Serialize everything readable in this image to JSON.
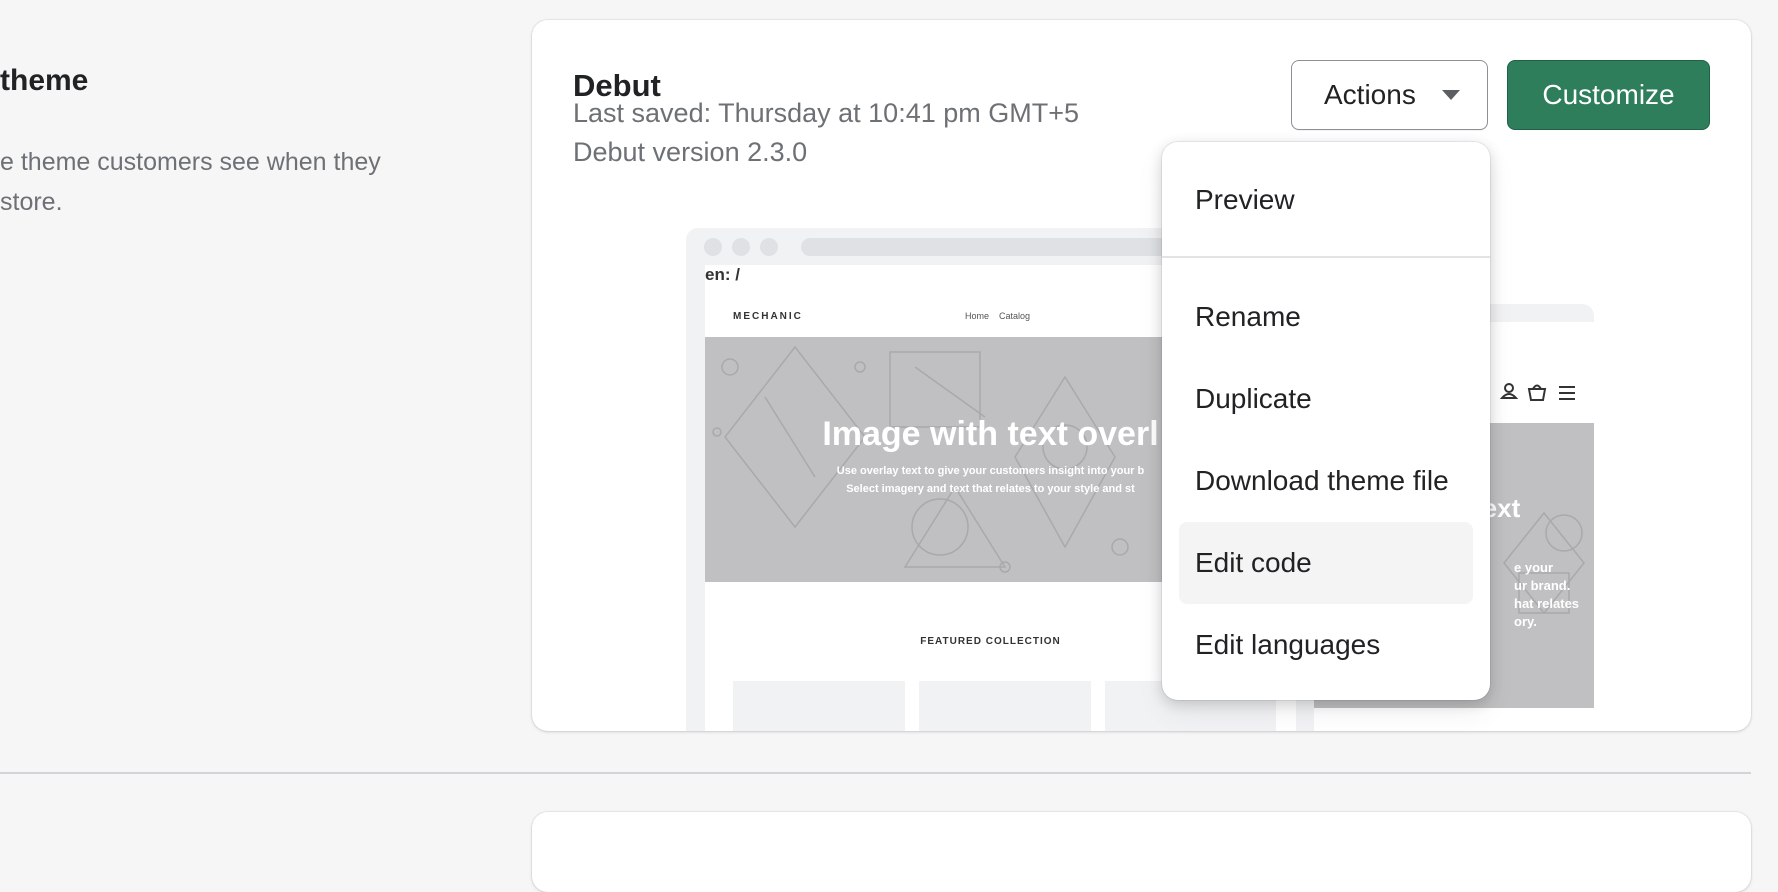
{
  "section": {
    "title": "theme",
    "description_line1": "e theme customers see when they",
    "description_line2": "store."
  },
  "theme_card": {
    "name": "Debut",
    "last_saved": "Last saved: Thursday at 10:41 pm GMT+5",
    "version": "Debut version 2.3.0",
    "actions_label": "Actions",
    "customize_label": "Customize"
  },
  "preview": {
    "error_text": "en: /",
    "store_logo": "MECHANIC",
    "nav": [
      "Home",
      "Catalog"
    ],
    "hero_title": "Image with text overl",
    "hero_sub1": "Use overlay text to give your customers insight into your b",
    "hero_sub2": "Select imagery and text that relates to your style and st",
    "featured": "FEATURED COLLECTION",
    "mobile_title": "text",
    "mobile_lines": [
      "e your",
      "ur brand.",
      "hat relates",
      "ory."
    ]
  },
  "actions_menu": {
    "items": [
      "Preview",
      "Rename",
      "Duplicate",
      "Download theme file",
      "Edit code",
      "Edit languages"
    ],
    "highlighted": "Edit code"
  },
  "colors": {
    "primary": "#2e7d5b",
    "background": "#f6f6f7",
    "hero_gray": "#c0c0c2"
  }
}
